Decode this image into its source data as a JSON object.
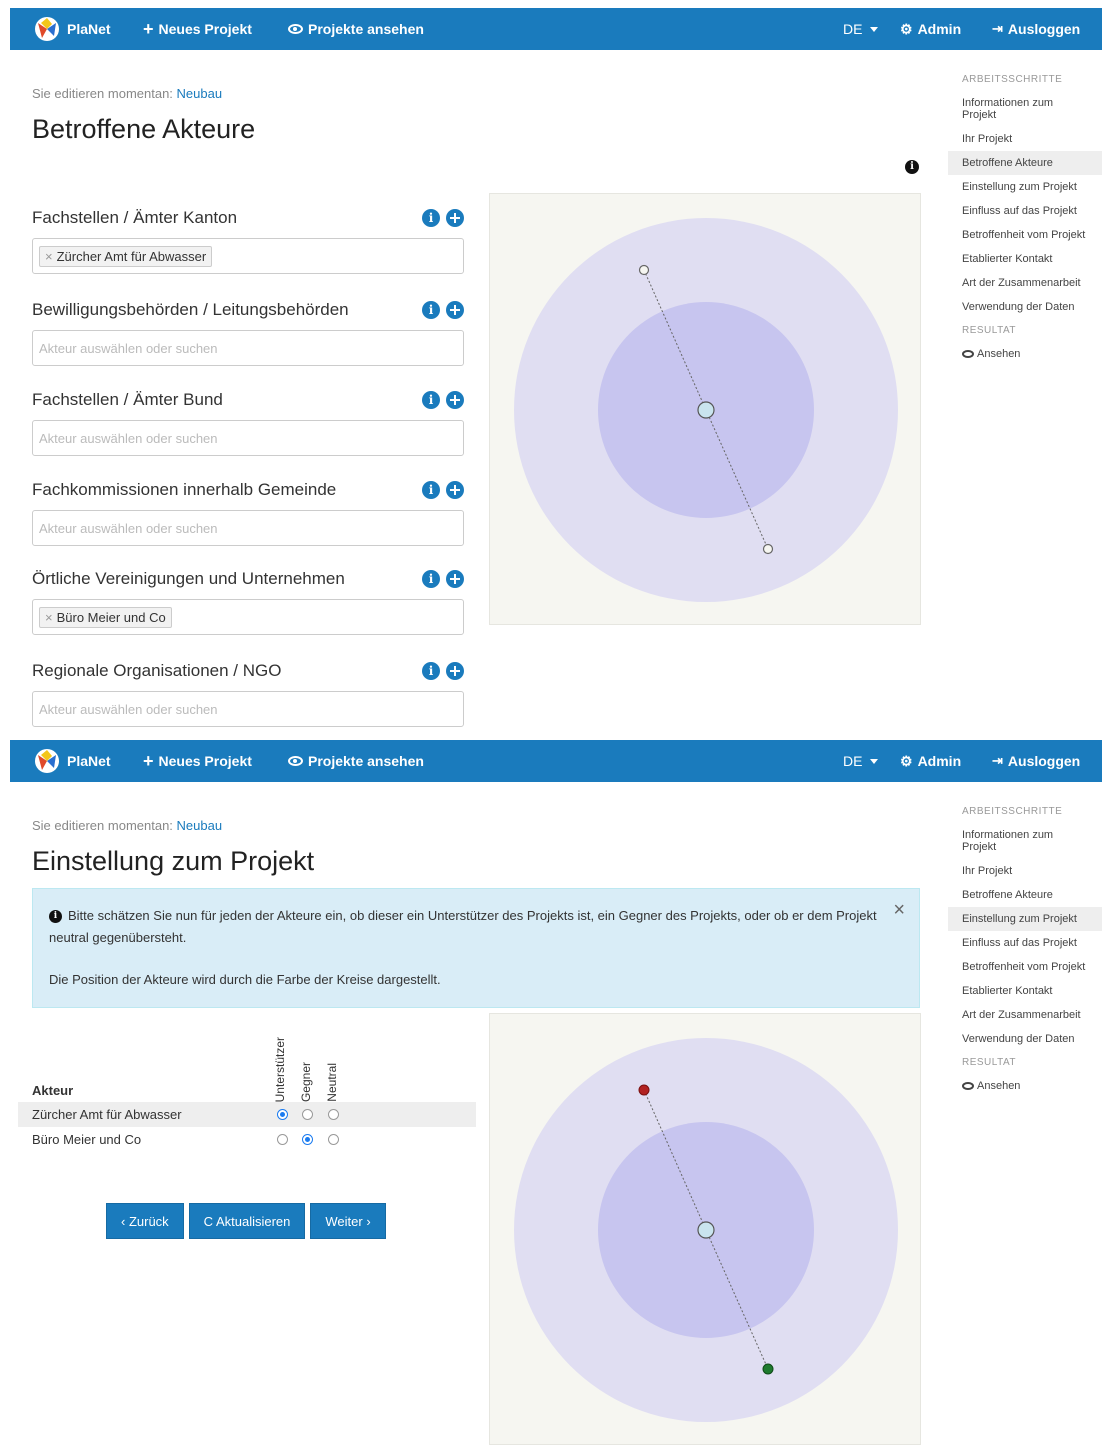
{
  "nav": {
    "brand": "PlaNet",
    "new_project": "Neues Projekt",
    "view_projects": "Projekte ansehen",
    "language": "DE",
    "admin": "Admin",
    "logout": "Ausloggen"
  },
  "editing": {
    "prefix": "Sie editieren momentan:",
    "project_name": "Neubau"
  },
  "sidebar": {
    "steps_heading": "ARBEITSSCHRITTE",
    "items": [
      "Informationen zum Projekt",
      "Ihr Projekt",
      "Betroffene Akteure",
      "Einstellung zum Projekt",
      "Einfluss auf das Projekt",
      "Betroffenheit vom Projekt",
      "Etablierter Kontakt",
      "Art der Zusammenarbeit",
      "Verwendung der Daten"
    ],
    "result_heading": "RESULTAT",
    "result_item": "Ansehen"
  },
  "screen1": {
    "title": "Betroffene Akteure",
    "placeholder": "Akteur auswählen oder suchen",
    "fields": [
      {
        "label": "Fachstellen / Ämter Kanton",
        "tag": "Zürcher Amt für Abwasser"
      },
      {
        "label": "Bewilligungsbehörden / Leitungsbehörden",
        "tag": ""
      },
      {
        "label": "Fachstellen / Ämter Bund",
        "tag": ""
      },
      {
        "label": "Fachkommissionen innerhalb Gemeinde",
        "tag": ""
      },
      {
        "label": "Örtliche Vereinigungen und Unternehmen",
        "tag": "Büro Meier und Co"
      },
      {
        "label": "Regionale Organisationen / NGO",
        "tag": ""
      }
    ]
  },
  "screen2": {
    "title": "Einstellung zum Projekt",
    "alert": {
      "line1": "Bitte schätzen Sie nun für jeden der Akteure ein, ob dieser ein Unterstützer des Projekts ist, ein Gegner des Projekts, oder ob er dem Projekt neutral gegenübersteht.",
      "line2": "Die Position der Akteure wird durch die Farbe der Kreise dargestellt.",
      "close": "×"
    },
    "table": {
      "col_actor": "Akteur",
      "col_support": "Unterstützer",
      "col_opponent": "Gegner",
      "col_neutral": "Neutral",
      "rows": [
        {
          "name": "Zürcher Amt für Abwasser",
          "selected": "support"
        },
        {
          "name": "Büro Meier und Co",
          "selected": "opponent"
        }
      ]
    },
    "buttons": {
      "back": "‹ Zurück",
      "refresh": "C Aktualisieren",
      "next": "Weiter ›"
    }
  },
  "colors": {
    "navbar": "#1a7bbd",
    "outer_circle": "#e0def2",
    "inner_circle": "#c7c5ef",
    "center_node": "#c9e4ee",
    "opponent_node": "#b22222",
    "supporter_node": "#1e7a2e"
  }
}
